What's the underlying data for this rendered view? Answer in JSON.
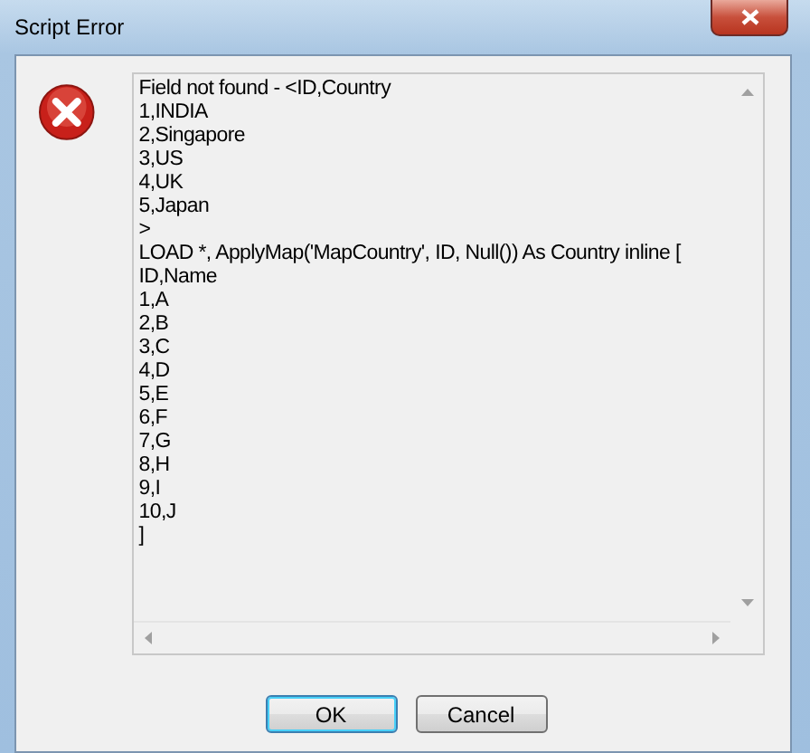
{
  "window": {
    "title": "Script Error"
  },
  "message": "Field not found - <ID,Country\n1,INDIA\n2,Singapore\n3,US\n4,UK\n5,Japan\n>\nLOAD *, ApplyMap('MapCountry', ID, Null()) As Country inline [\nID,Name\n1,A\n2,B\n3,C\n4,D\n5,E\n6,F\n7,G\n8,H\n9,I\n10,J\n]",
  "buttons": [
    {
      "label": "OK",
      "default": true
    },
    {
      "label": "Cancel",
      "default": false
    }
  ]
}
